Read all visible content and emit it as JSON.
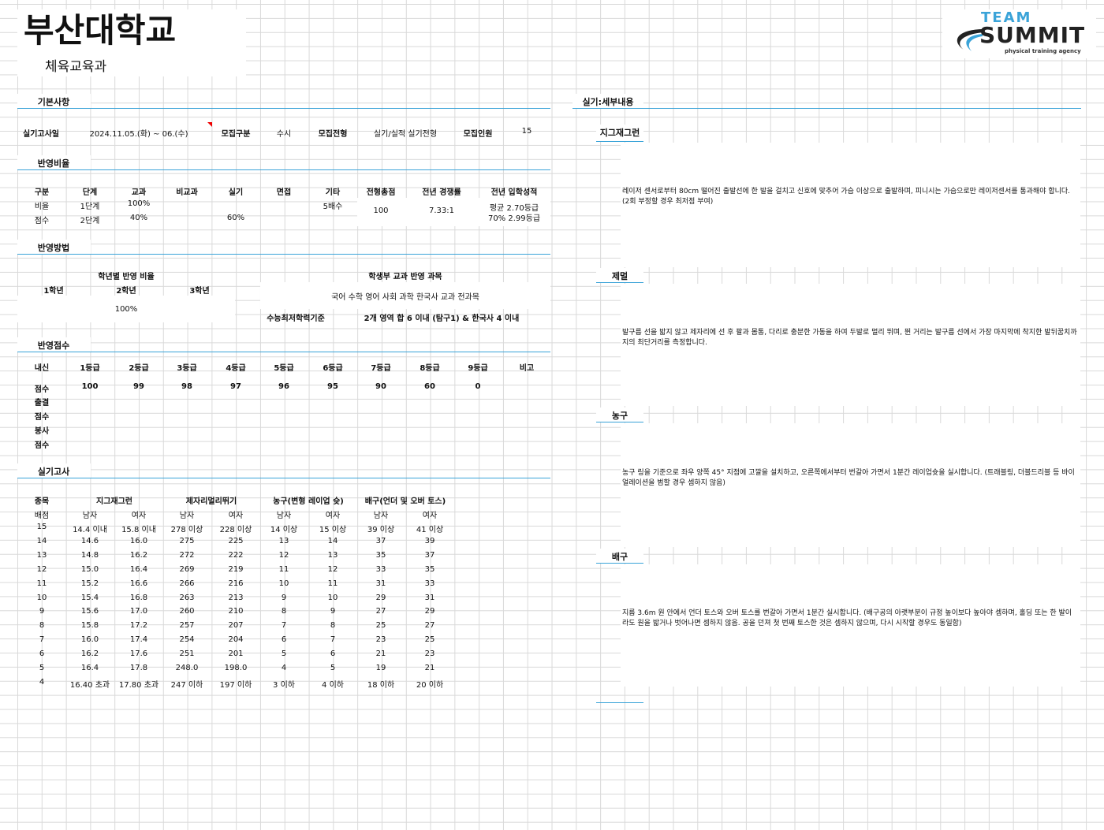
{
  "header": {
    "university": "부산대학교",
    "department": "체육교육과"
  },
  "logo": {
    "team": "TEAM",
    "summit": "SUMMIT",
    "tagline": "physical training agency",
    "accent": "#3aa3d8"
  },
  "basic": {
    "section": "기본사항",
    "exam_date_label": "실기고사일",
    "exam_date": "2024.11.05.(화) ~ 06.(수)",
    "type_label": "모집구분",
    "type": "수시",
    "track_label": "모집전형",
    "track": "실기/실적 실기전형",
    "quota_label": "모집인원",
    "quota": "15"
  },
  "ratio": {
    "section": "반영비율",
    "headers": [
      "구분",
      "단계",
      "교과",
      "비교과",
      "실기",
      "면접",
      "기타",
      "전형총점",
      "전년 경쟁률",
      "전년 입학성적"
    ],
    "row1": {
      "label": "비율",
      "stage": "1단계",
      "subject": "100%",
      "etc": "5배수"
    },
    "row2": {
      "label": "점수",
      "stage": "2단계",
      "subject": "40%",
      "practical": "60%"
    },
    "total": "100",
    "competition": "7.33:1",
    "admit1": "평균 2.70등급",
    "admit2": "70% 2.99등급"
  },
  "method": {
    "section": "반영방법",
    "grade_ratio_title": "학년별 반영 비율",
    "grades": [
      "1학년",
      "2학년",
      "3학년"
    ],
    "grade_value": "100%",
    "subjects_title": "학생부 교과 반영 과목",
    "subjects": "국어 수학 영어 사회 과학 한국사 교과 전과목",
    "min_label": "수능최저학력기준",
    "min_value": "2개 영역 합 6 이내 (탐구1) & 한국사 4 이내"
  },
  "score": {
    "section": "반영점수",
    "headers": [
      "내신",
      "1등급",
      "2등급",
      "3등급",
      "4등급",
      "5등급",
      "6등급",
      "7등급",
      "8등급",
      "9등급",
      "비고"
    ],
    "row_label": "점수",
    "values": [
      "100",
      "99",
      "98",
      "97",
      "96",
      "95",
      "90",
      "60",
      "0"
    ],
    "extra_labels": [
      "출결",
      "점수",
      "봉사",
      "점수"
    ]
  },
  "practical": {
    "section": "실기고사",
    "col0": "종목",
    "row_header": "배점",
    "events": [
      "지그재그런",
      "제자리멀리뛰기",
      "농구(변형 레이업 슛)",
      "배구(언더 및 오버 토스)"
    ],
    "male": "남자",
    "female": "여자",
    "rows": [
      [
        "15",
        "14.4 이내",
        "15.8 이내",
        "278 이상",
        "228 이상",
        "14 이상",
        "15 이상",
        "39 이상",
        "41 이상"
      ],
      [
        "14",
        "14.6",
        "16.0",
        "275",
        "225",
        "13",
        "14",
        "37",
        "39"
      ],
      [
        "13",
        "14.8",
        "16.2",
        "272",
        "222",
        "12",
        "13",
        "35",
        "37"
      ],
      [
        "12",
        "15.0",
        "16.4",
        "269",
        "219",
        "11",
        "12",
        "33",
        "35"
      ],
      [
        "11",
        "15.2",
        "16.6",
        "266",
        "216",
        "10",
        "11",
        "31",
        "33"
      ],
      [
        "10",
        "15.4",
        "16.8",
        "263",
        "213",
        "9",
        "10",
        "29",
        "31"
      ],
      [
        "9",
        "15.6",
        "17.0",
        "260",
        "210",
        "8",
        "9",
        "27",
        "29"
      ],
      [
        "8",
        "15.8",
        "17.2",
        "257",
        "207",
        "7",
        "8",
        "25",
        "27"
      ],
      [
        "7",
        "16.0",
        "17.4",
        "254",
        "204",
        "6",
        "7",
        "23",
        "25"
      ],
      [
        "6",
        "16.2",
        "17.6",
        "251",
        "201",
        "5",
        "6",
        "21",
        "23"
      ],
      [
        "5",
        "16.4",
        "17.8",
        "248.0",
        "198.0",
        "4",
        "5",
        "19",
        "21"
      ],
      [
        "4",
        "16.40 초과",
        "17.80 초과",
        "247 이하",
        "197 이하",
        "3 이하",
        "4 이하",
        "18 이하",
        "20 이하"
      ]
    ]
  },
  "details": {
    "section": "실기:세부내용",
    "items": [
      {
        "title": "지그재그런",
        "desc": "레이저 센서로부터 80cm 떨어진 출발선에 한 발을 걸치고 신호에 맞추어 가슴 이상으로 출발하며, 피니시는 가슴으로만 레이저센서를 통과해야 합니다. (2회 부정할 경우 최저점 부여)"
      },
      {
        "title": "제멀",
        "desc": "발구름 선을 밟지 않고 제자리에 선 후 팔과 몸통, 다리로 충분한 가동을 하여 두발로 멀리 뛰며, 뛴 거리는 발구름 선에서 가장 마지막에 착지한 발뒤꿈치까지의 최단거리를 측정합니다."
      },
      {
        "title": "농구",
        "desc": "농구 링을 기준으로 좌우 양쪽 45° 지점에 고깔을 설치하고, 오른쪽에서부터 번갈아 가면서 1분간 레이업슛을 실시합니다. (트래블링, 더블드리블 등 바이얼레이션을 범할 경우 셈하지 않음)"
      },
      {
        "title": "배구",
        "desc": "지름 3.6m 원 안에서 언더 토스와 오버 토스를 번갈아 가면서 1분간 실시합니다. (배구공의 아랫부분이 규정 높이보다 높아야 셈하며, 홀딩 또는 한 발이라도 원을 밟거나 벗어나면 셈하지 않음. 공을 던져 첫 번째 토스한 것은 셈하지 않으며, 다시 시작할 경우도 동일함)"
      }
    ]
  }
}
